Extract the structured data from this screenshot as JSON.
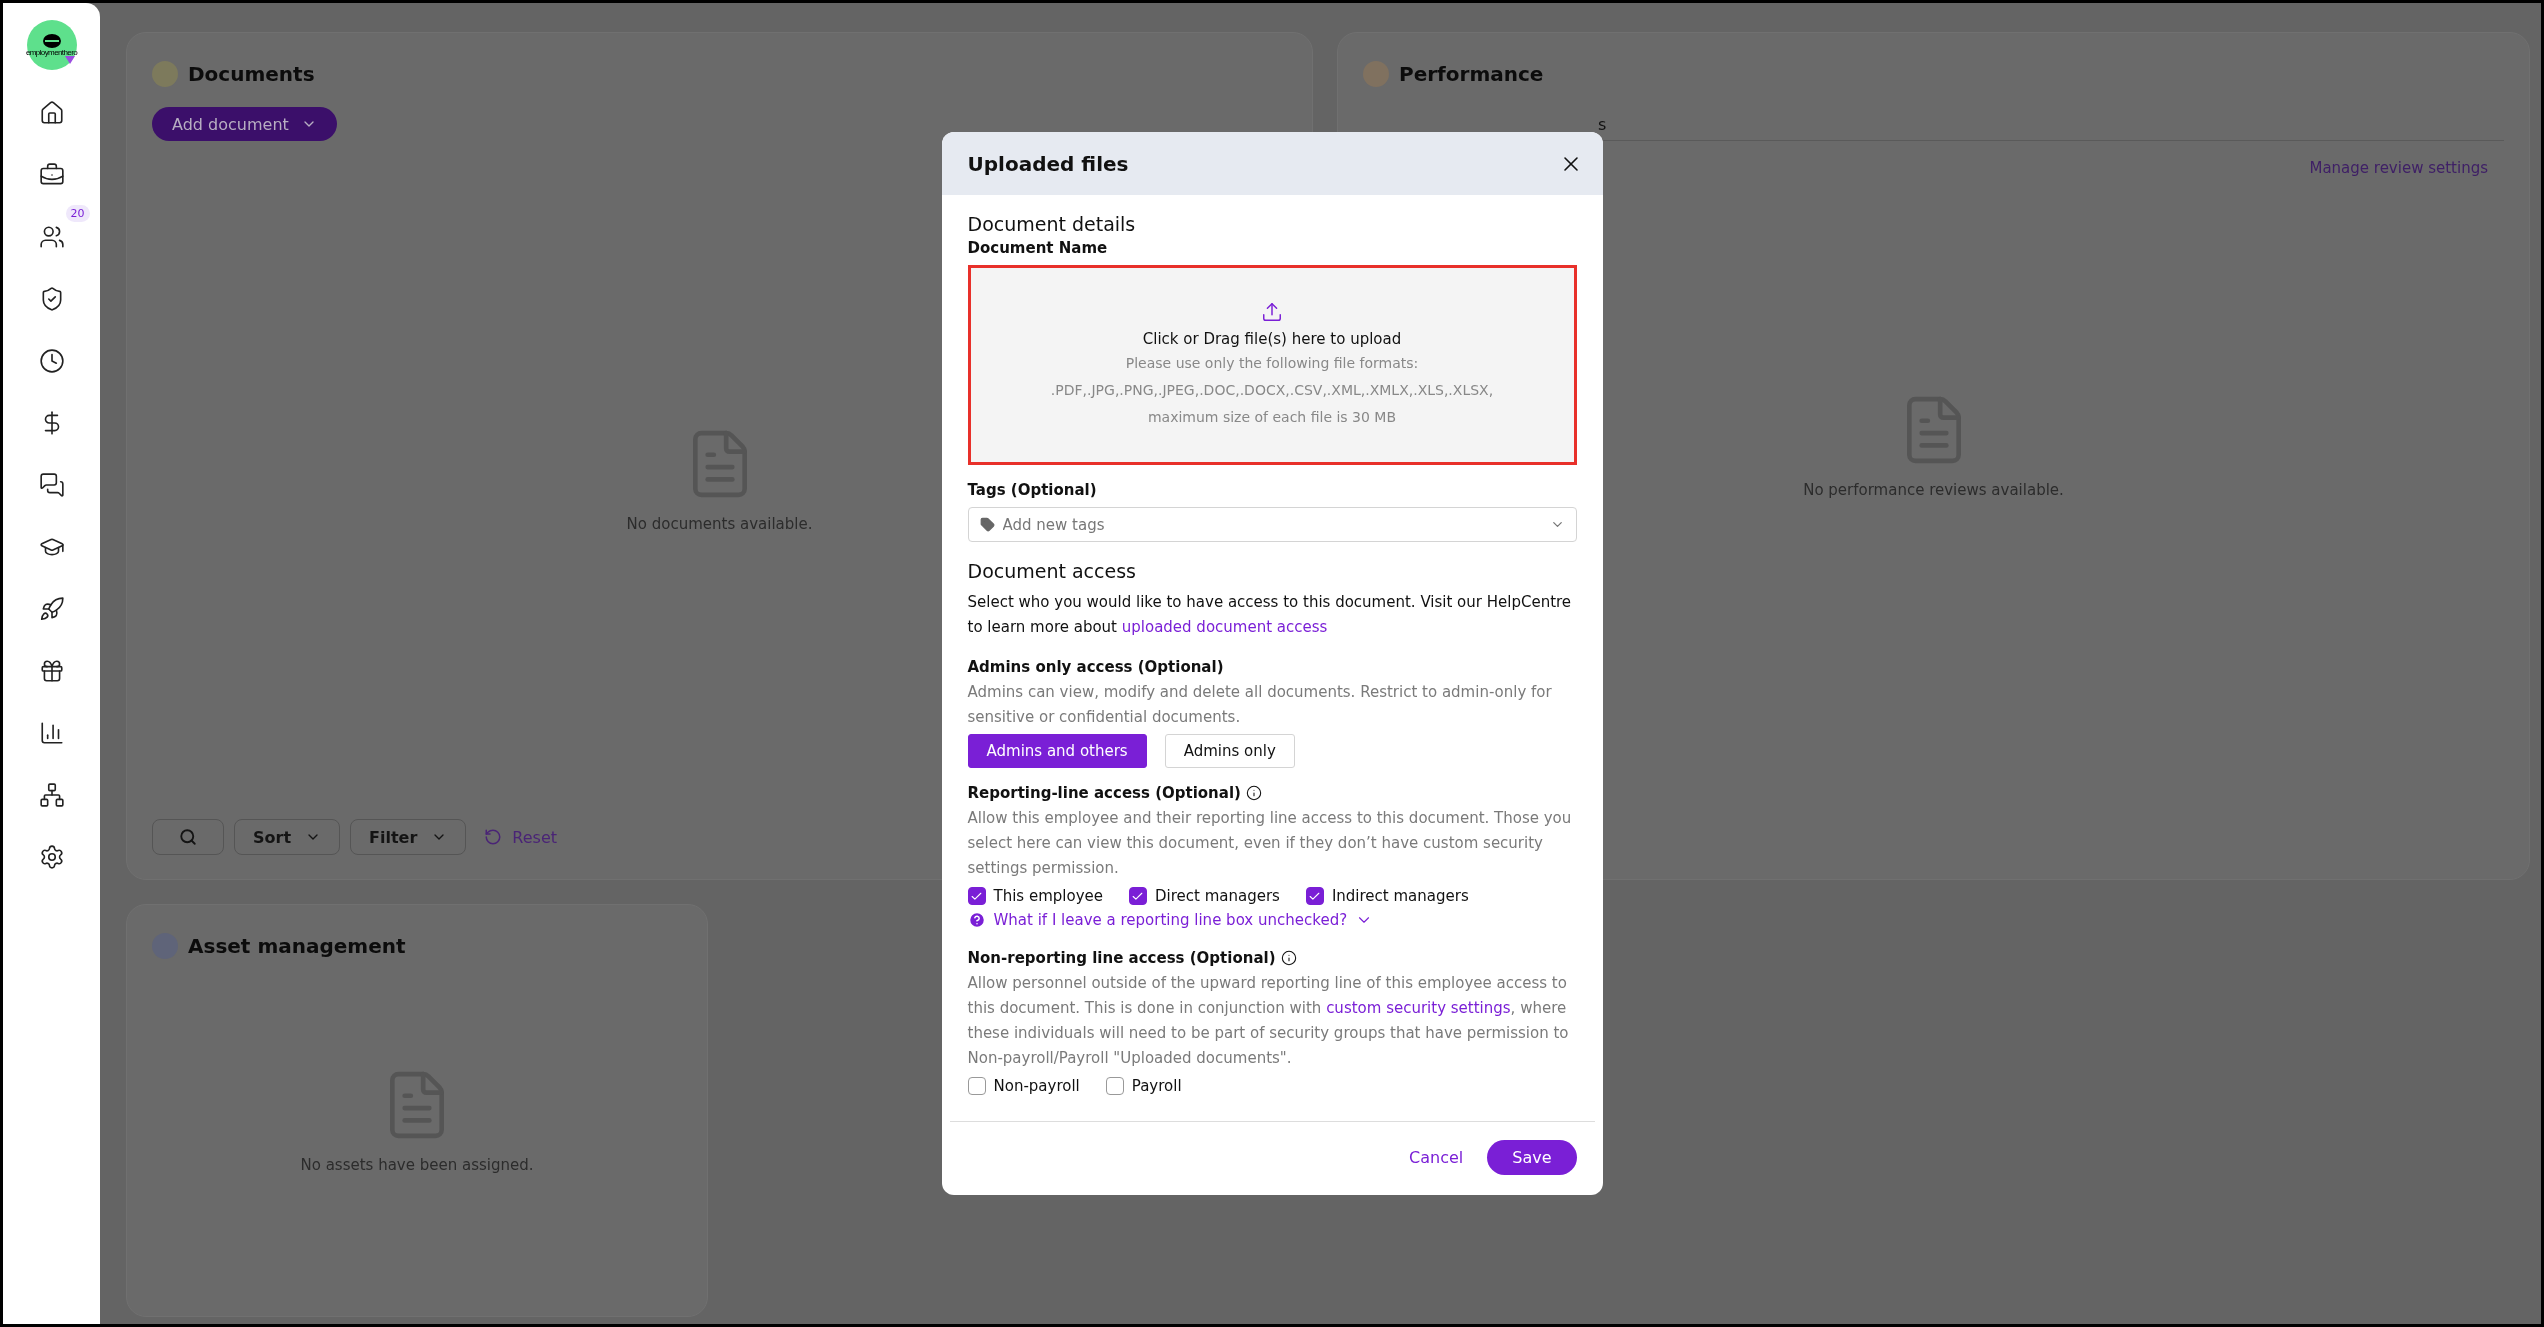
{
  "sidebar": {
    "logo": {
      "text": "employmenthero"
    },
    "items": [
      {
        "selected": false
      },
      {
        "selected": false
      },
      {
        "selected": false,
        "badge": "20"
      },
      {
        "selected": false
      },
      {
        "selected": false
      },
      {
        "selected": false
      },
      {
        "selected": false
      },
      {
        "selected": false
      },
      {
        "selected": false
      },
      {
        "selected": false
      },
      {
        "selected": false
      },
      {
        "selected": false
      },
      {
        "selected": false
      }
    ]
  },
  "documents_card": {
    "title": "Documents",
    "color": "#7d7a5c",
    "add_button": "Add document",
    "empty_text": "No documents available.",
    "toolbar": {
      "sort": "Sort",
      "filter": "Filter",
      "reset": "Reset"
    }
  },
  "performance_card": {
    "title": "Performance",
    "color": "#80715f",
    "tab_fragment": "s",
    "link": "Manage review settings",
    "empty_text": "No performance reviews available."
  },
  "asset_card": {
    "title": "Asset management",
    "color": "#5f6479",
    "empty_text": "No assets have been assigned."
  },
  "modal": {
    "title": "Uploaded files",
    "details_heading": "Document details",
    "name_label": "Document Name",
    "dropzone": {
      "title": "Click or Drag file(s) here to upload",
      "lines": [
        "Please use only the following file formats:",
        ".PDF,.JPG,.PNG,.JPEG,.DOC,.DOCX,.CSV,.XML,.XMLX,.XLS,.XLSX,",
        "maximum size of each file is 30 MB"
      ]
    },
    "tags": {
      "label": "Tags (Optional)",
      "placeholder": "Add new tags"
    },
    "access_heading": "Document access",
    "access_intro": "Select who you would like to have access to this document. Visit our HelpCentre to learn more about ",
    "access_link": "uploaded document access",
    "admins": {
      "label": "Admins only access (Optional)",
      "description": "Admins can view, modify and delete all documents. Restrict to admin-only for sensitive or confidential documents.",
      "options": [
        {
          "label": "Admins and others",
          "selected": true
        },
        {
          "label": "Admins only",
          "selected": false
        }
      ]
    },
    "reporting": {
      "label": "Reporting-line access (Optional)",
      "description": "Allow this employee and their reporting line access to this document. Those you select here can view this document, even if they don’t have custom security settings permission.",
      "checkboxes": [
        {
          "label": "This employee",
          "checked": true
        },
        {
          "label": "Direct managers",
          "checked": true
        },
        {
          "label": "Indirect managers",
          "checked": true
        }
      ],
      "help_link": "What if I leave a reporting line box unchecked?"
    },
    "non_reporting": {
      "label": "Non-reporting line access (Optional)",
      "description_before": "Allow personnel outside of the upward reporting line of this employee access to this document. This is done in conjunction with ",
      "description_link": "custom security settings",
      "description_after": ", where these individuals will need to be part of security groups that have permission to Non-payroll/Payroll \"Uploaded documents\".",
      "checkboxes": [
        {
          "label": "Non-payroll",
          "checked": false
        },
        {
          "label": "Payroll",
          "checked": false
        }
      ]
    },
    "buttons": {
      "cancel": "Cancel",
      "save": "Save"
    }
  }
}
